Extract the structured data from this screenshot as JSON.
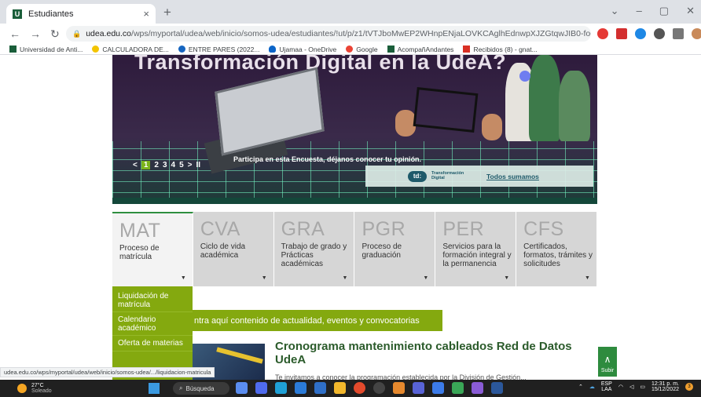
{
  "browser": {
    "tab_title": "Estudiantes",
    "tab_close": "×",
    "new_tab": "+",
    "window_controls": [
      "⌄",
      "–",
      "▢",
      "✕"
    ],
    "url_host": "udea.edu.co",
    "url_path": "/wps/myportal/udea/web/inicio/somos-udea/estudiantes/!ut/p/z1/tVTJboMwEP2WHnpENjaLOVKCAglhEdnwpXJZGtqwJIB0-fo6bVqplU...",
    "bookmarks": [
      {
        "label": "Universidad de Anti..."
      },
      {
        "label": "CALCULADORA DE..."
      },
      {
        "label": "ENTRE PARES (2022..."
      },
      {
        "label": "Ujamaa - OneDrive"
      },
      {
        "label": "Google"
      },
      {
        "label": "AcompañAndantes"
      },
      {
        "label": "Recibidos (8) - gnat..."
      }
    ]
  },
  "banner": {
    "title": "Transformación Digital en la UdeA?",
    "carousel": {
      "prev": "<",
      "pages": [
        "1",
        "2",
        "3",
        "4",
        "5"
      ],
      "current": "1",
      "next": ">",
      "pause": "II"
    },
    "poll_text": "Participa en esta Encuesta, déjanos conocer tu opinión.",
    "td_logo": "td:",
    "td_label": "Transformación Digital",
    "td_cta": "Todos sumamos"
  },
  "nav": [
    {
      "code": "MAT",
      "desc": "Proceso de matrícula"
    },
    {
      "code": "CVA",
      "desc": "Ciclo de vida académica"
    },
    {
      "code": "GRA",
      "desc": "Trabajo de grado y Prácticas académicas"
    },
    {
      "code": "PGR",
      "desc": "Proceso de graduación"
    },
    {
      "code": "PER",
      "desc": "Servicios para la formación integral y la permanencia"
    },
    {
      "code": "CFS",
      "desc": "Certificados, formatos, trámites y solicitudes"
    }
  ],
  "dropdown": [
    "Liquidación de matrícula",
    "Calendario académico",
    "Oferta de materias"
  ],
  "news": {
    "bar_text": "ntra aquí contenido de actualidad, eventos y convocatorias",
    "title": "Cronograma mantenimiento cableados Red de Datos UdeA",
    "subtitle": "Te invitamos a conocer la programación establecida por la División de Gestión..."
  },
  "scroll_top": "Subir",
  "status_url": "udea.edu.co/wps/myportal/udea/web/inicio/somos-udea/.../liquidacion-matricula",
  "taskbar": {
    "temp": "27°C",
    "weather": "Soleado",
    "search": "Búsqueda",
    "lang": "ESP",
    "lang2": "LAA",
    "time": "12:31 p. m.",
    "date": "15/12/2022",
    "notifications": "3"
  }
}
